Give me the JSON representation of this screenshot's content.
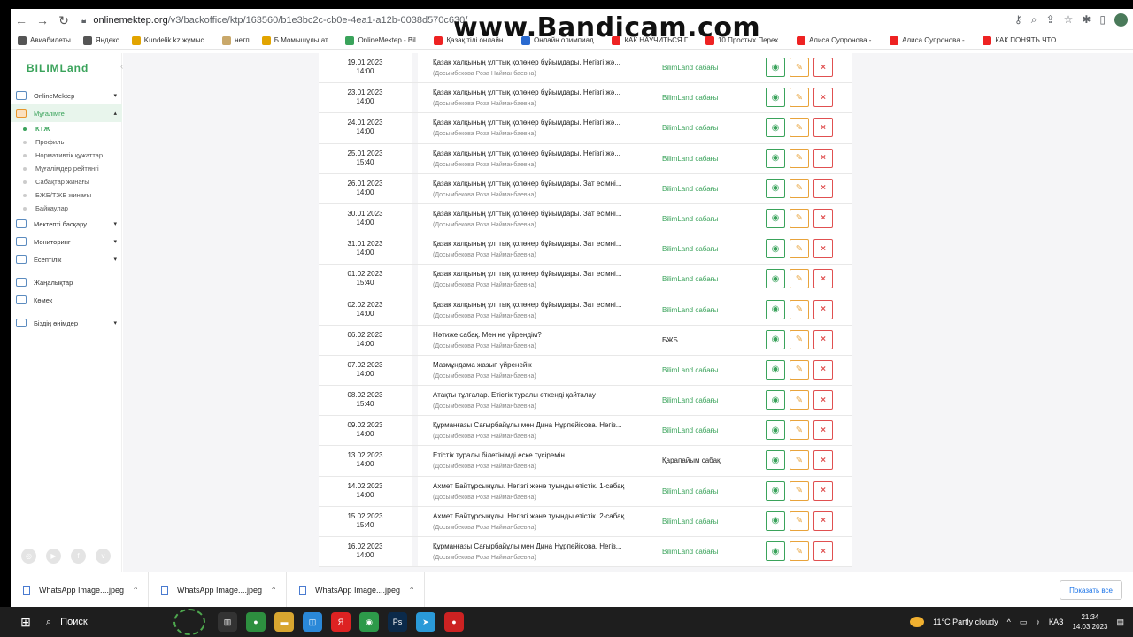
{
  "browser": {
    "url_host": "onlinemektep.org",
    "url_path": "/v3/backoffice/ktp/163560/b1e3bc2c-cb0e-4ea1-a12b-0038d570c630/",
    "watermark": "www.Bandicam.com",
    "bookmarks": [
      {
        "label": "Авиабилеты",
        "color": "#555"
      },
      {
        "label": "Яндекс",
        "color": "#555"
      },
      {
        "label": "Kundelik.kz жұмыс...",
        "color": "#e2a400"
      },
      {
        "label": "нетп",
        "color": "#c9a86a"
      },
      {
        "label": "Б.Момышұлы ат...",
        "color": "#e2a400"
      },
      {
        "label": "OnlineMektep - Bil...",
        "color": "#3aa35b"
      },
      {
        "label": "Қазақ тілі онлайн...",
        "color": "#e22"
      },
      {
        "label": "Онлайн олимпиад...",
        "color": "#2a6ad0"
      },
      {
        "label": "КАК НАУЧИТЬСЯ Г...",
        "color": "#e22"
      },
      {
        "label": "10 Простых Перех...",
        "color": "#e22"
      },
      {
        "label": "Алиса Супронова -...",
        "color": "#e22"
      },
      {
        "label": "Алиса Супронова -...",
        "color": "#e22"
      },
      {
        "label": "КАК ПОНЯТЬ ЧТО...",
        "color": "#e22"
      }
    ]
  },
  "sidebar": {
    "logo": "BILIMLand",
    "items": [
      {
        "label": "OnlineMektep",
        "chev": "▾",
        "active": false
      },
      {
        "label": "Мұғалімге",
        "chev": "▴",
        "active": true
      }
    ],
    "sub_items": [
      {
        "label": "КТЖ",
        "selected": true
      },
      {
        "label": "Профиль",
        "selected": false
      },
      {
        "label": "Нормативтік құжаттар",
        "selected": false
      },
      {
        "label": "Мұғалімдер рейтингі",
        "selected": false
      },
      {
        "label": "Сабақтар жинағы",
        "selected": false
      },
      {
        "label": "БЖБ/ТЖБ жинағы",
        "selected": false
      },
      {
        "label": "Байқаулар",
        "selected": false
      }
    ],
    "items2": [
      {
        "label": "Мектепті басқару",
        "chev": "▾"
      },
      {
        "label": "Мониторинг",
        "chev": "▾"
      },
      {
        "label": "Есептілік",
        "chev": "▾"
      }
    ],
    "items3": [
      {
        "label": "Жаңалықтар",
        "chev": ""
      },
      {
        "label": "Көмек",
        "chev": ""
      }
    ],
    "items4": [
      {
        "label": "Біздің өнімдер",
        "chev": "▾"
      }
    ]
  },
  "lessons": [
    {
      "date": "19.01.2023",
      "time": "14:00",
      "title": "Қазақ халқының ұлттық қолөнер бұйымдары. Негізгі жә...",
      "teacher": "(Досымбекова Роза Найманбаевна)",
      "type": "BilimLand сабағы",
      "plain": false
    },
    {
      "date": "23.01.2023",
      "time": "14:00",
      "title": "Қазақ халқының ұлттық қолөнер бұйымдары. Негізгі жә...",
      "teacher": "(Досымбекова Роза Найманбаевна)",
      "type": "BilimLand сабағы",
      "plain": false
    },
    {
      "date": "24.01.2023",
      "time": "14:00",
      "title": "Қазақ халқының ұлттық қолөнер бұйымдары. Негізгі жә...",
      "teacher": "(Досымбекова Роза Найманбаевна)",
      "type": "BilimLand сабағы",
      "plain": false
    },
    {
      "date": "25.01.2023",
      "time": "15:40",
      "title": "Қазақ халқының ұлттық қолөнер бұйымдары. Негізгі жә...",
      "teacher": "(Досымбекова Роза Найманбаевна)",
      "type": "BilimLand сабағы",
      "plain": false
    },
    {
      "date": "26.01.2023",
      "time": "14:00",
      "title": "Қазақ халқының ұлттық қолөнер бұйымдары. Зат есімні...",
      "teacher": "(Досымбекова Роза Найманбаевна)",
      "type": "BilimLand сабағы",
      "plain": false
    },
    {
      "date": "30.01.2023",
      "time": "14:00",
      "title": "Қазақ халқының ұлттық қолөнер бұйымдары. Зат есімні...",
      "teacher": "(Досымбекова Роза Найманбаевна)",
      "type": "BilimLand сабағы",
      "plain": false
    },
    {
      "date": "31.01.2023",
      "time": "14:00",
      "title": "Қазақ халқының ұлттық қолөнер бұйымдары. Зат есімні...",
      "teacher": "(Досымбекова Роза Найманбаевна)",
      "type": "BilimLand сабағы",
      "plain": false
    },
    {
      "date": "01.02.2023",
      "time": "15:40",
      "title": "Қазақ халқының ұлттық қолөнер бұйымдары. Зат есімні...",
      "teacher": "(Досымбекова Роза Найманбаевна)",
      "type": "BilimLand сабағы",
      "plain": false
    },
    {
      "date": "02.02.2023",
      "time": "14:00",
      "title": "Қазақ халқының ұлттық қолөнер бұйымдары. Зат есімні...",
      "teacher": "(Досымбекова Роза Найманбаевна)",
      "type": "BilimLand сабағы",
      "plain": false
    },
    {
      "date": "06.02.2023",
      "time": "14:00",
      "title": "Нәтиже сабақ. Мен не үйрендім?",
      "teacher": "(Досымбекова Роза Найманбаевна)",
      "type": "БЖБ",
      "plain": true
    },
    {
      "date": "07.02.2023",
      "time": "14:00",
      "title": "Мазмұндама жазып үйренейік",
      "teacher": "(Досымбекова Роза Найманбаевна)",
      "type": "BilimLand сабағы",
      "plain": false
    },
    {
      "date": "08.02.2023",
      "time": "15:40",
      "title": "Атақты тұлғалар. Етістік туралы өткенді қайталау",
      "teacher": "(Досымбекова Роза Найманбаевна)",
      "type": "BilimLand сабағы",
      "plain": false
    },
    {
      "date": "09.02.2023",
      "time": "14:00",
      "title": "Құрманғазы Сағырбайұлы мен Дина Нұрпейісова. Негіз...",
      "teacher": "(Досымбекова Роза Найманбаевна)",
      "type": "BilimLand сабағы",
      "plain": false
    },
    {
      "date": "13.02.2023",
      "time": "14:00",
      "title": "Етістік туралы білетінімді еске түсіремін.",
      "teacher": "(Досымбекова Роза Найманбаевна)",
      "type": "Қарапайым сабақ",
      "plain": true
    },
    {
      "date": "14.02.2023",
      "time": "14:00",
      "title": "Ахмет Байтұрсынұлы. Негізгі және туынды етістік. 1-сабақ",
      "teacher": "(Досымбекова Роза Найманбаевна)",
      "type": "BilimLand сабағы",
      "plain": false
    },
    {
      "date": "15.02.2023",
      "time": "15:40",
      "title": "Ахмет Байтұрсынұлы. Негізгі және туынды етістік. 2-сабақ",
      "teacher": "(Досымбекова Роза Найманбаевна)",
      "type": "BilimLand сабағы",
      "plain": false
    },
    {
      "date": "16.02.2023",
      "time": "14:00",
      "title": "Құрманғазы Сағырбайұлы мен Дина Нұрпейісова. Негіз...",
      "teacher": "(Досымбекова Роза Найманбаевна)",
      "type": "BilimLand сабағы",
      "plain": false
    }
  ],
  "downloads": {
    "files": [
      "WhatsApp Image....jpeg",
      "WhatsApp Image....jpeg",
      "WhatsApp Image....jpeg"
    ],
    "show_all": "Показать все"
  },
  "taskbar": {
    "search": "Поиск",
    "weather": "11°C  Partly cloudy",
    "lang": "КАЗ",
    "time": "21:34",
    "date": "14.03.2023"
  },
  "colors": {
    "accent": "#3aa35b",
    "edit": "#e8a33b",
    "delete": "#e05050"
  }
}
